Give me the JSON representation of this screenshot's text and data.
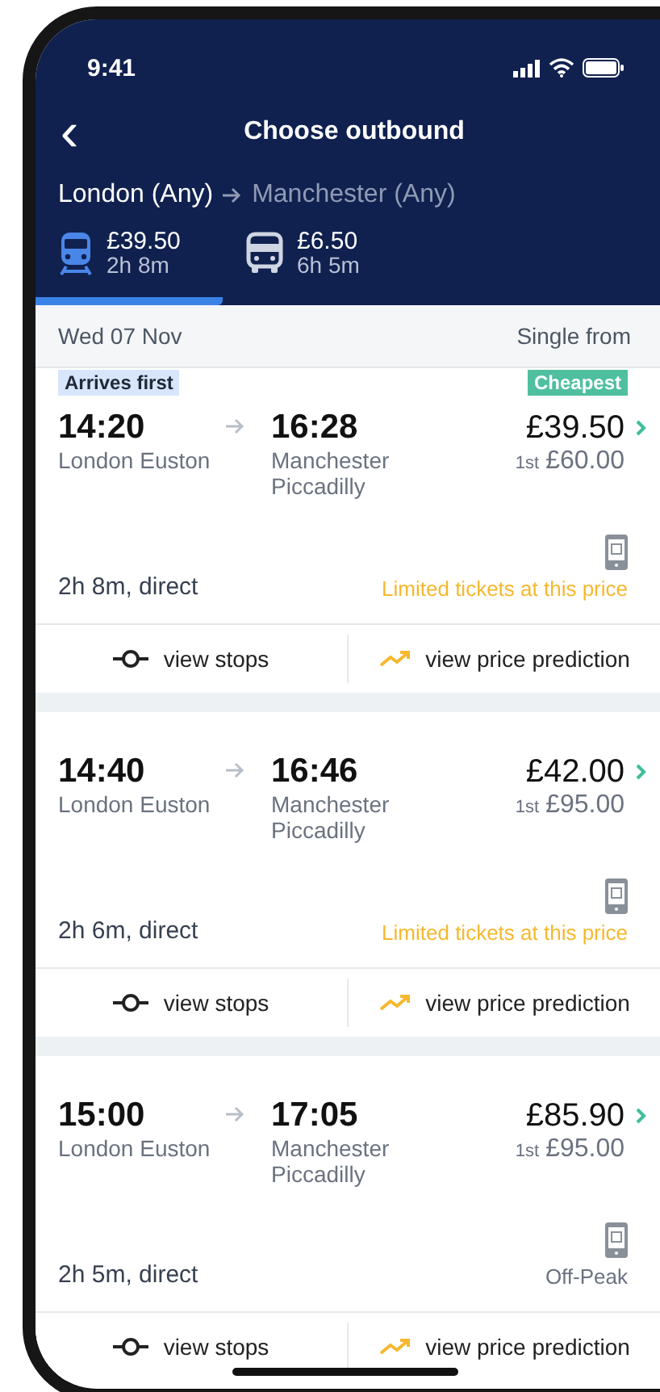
{
  "status_bar": {
    "time": "9:41"
  },
  "header": {
    "back": "‹",
    "title": "Choose outbound",
    "origin": "London (Any)",
    "destination": "Manchester (Any)"
  },
  "modes": [
    {
      "kind": "train",
      "price": "£39.50",
      "duration": "2h 8m",
      "selected": true
    },
    {
      "kind": "bus",
      "price": "£6.50",
      "duration": "6h 5m",
      "selected": false
    }
  ],
  "date_bar": {
    "date": "Wed 07 Nov",
    "label": "Single from"
  },
  "journeys": [
    {
      "badges": [
        {
          "text": "Arrives first",
          "kind": "info"
        },
        {
          "text": "Cheapest",
          "kind": "deal"
        }
      ],
      "depart_time": "14:20",
      "depart_station": "London Euston",
      "arrive_time": "16:28",
      "arrive_station": "Manchester Piccadilly",
      "price": "£39.50",
      "class_label": "1st",
      "first_price": "£60.00",
      "duration": "2h 8m, direct",
      "note": {
        "text": "Limited tickets at this price",
        "kind": "warning"
      },
      "actions": [
        "view stops",
        "view price prediction"
      ]
    },
    {
      "depart_time": "14:40",
      "depart_station": "London Euston",
      "arrive_time": "16:46",
      "arrive_station": "Manchester Piccadilly",
      "price": "£42.00",
      "class_label": "1st",
      "first_price": "£95.00",
      "duration": "2h 6m, direct",
      "note": {
        "text": "Limited tickets at this price",
        "kind": "warning"
      },
      "actions": [
        "view stops",
        "view price prediction"
      ]
    },
    {
      "depart_time": "15:00",
      "depart_station": "London Euston",
      "arrive_time": "17:05",
      "arrive_station": "Manchester Piccadilly",
      "price": "£85.90",
      "class_label": "1st",
      "first_price": "£95.00",
      "duration": "2h 5m, direct",
      "note": {
        "text": "Off-Peak",
        "kind": "plain"
      },
      "actions": [
        "view stops",
        "view price prediction"
      ]
    }
  ]
}
